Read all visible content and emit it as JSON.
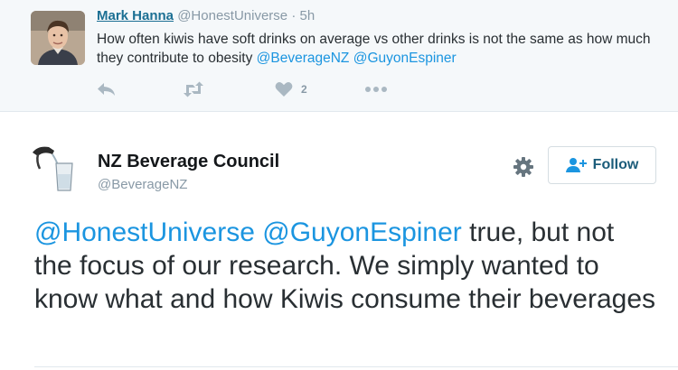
{
  "parent_tweet": {
    "name": "Mark Hanna",
    "handle": "@HonestUniverse",
    "separator": "·",
    "time": "5h",
    "text_before": "How often kiwis have soft drinks on average vs other drinks is not the same as how much they contribute to obesity ",
    "mention_1": "@BeverageNZ",
    "mention_2": "@GuyonEspiner",
    "like_count": "2"
  },
  "main_tweet": {
    "name": "NZ Beverage Council",
    "handle": "@BeverageNZ",
    "mention_1": "@HonestUniverse",
    "mention_2": "@GuyonEspiner",
    "text_after": " true, but not the focus of our research.  We simply wanted to know what and how Kiwis consume their beverages"
  },
  "follow_button": {
    "label": "Follow"
  },
  "colors": {
    "link": "#1b95e0",
    "parent_background": "#f5f8fa",
    "name_link": "#1b6f93"
  },
  "icons": {
    "reply": "reply-icon",
    "retweet": "retweet-icon",
    "like": "heart-icon",
    "more": "more-icon",
    "settings": "gear-icon",
    "follow": "add-person-icon"
  }
}
